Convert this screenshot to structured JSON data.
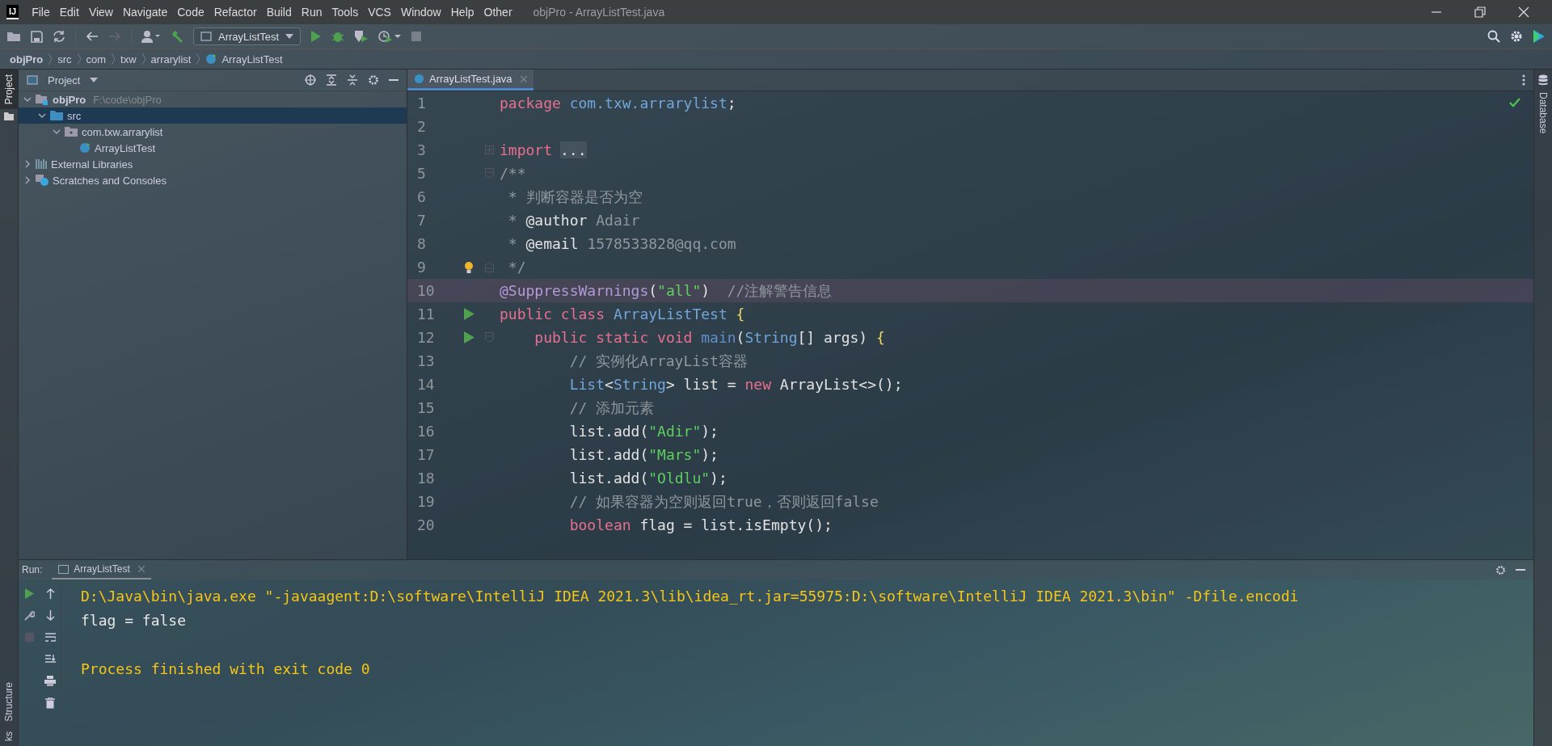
{
  "window": {
    "logo_text": "IJ",
    "title": "objPro - ArrayListTest.java"
  },
  "menu": [
    "File",
    "Edit",
    "View",
    "Navigate",
    "Code",
    "Refactor",
    "Build",
    "Run",
    "Tools",
    "VCS",
    "Window",
    "Help",
    "Other"
  ],
  "toolbar": {
    "run_config": "ArrayListTest"
  },
  "breadcrumbs": [
    "objPro",
    "src",
    "com",
    "txw",
    "arrarylist",
    "ArrayListTest"
  ],
  "left_stripe": {
    "top": [
      {
        "label": "Project",
        "selected": true
      }
    ],
    "bottom": [
      {
        "label": "Structure",
        "selected": false
      },
      {
        "label": "ks",
        "selected": false
      }
    ]
  },
  "right_stripe": [
    {
      "label": "Database",
      "selected": false
    }
  ],
  "project": {
    "title": "Project",
    "tree": [
      {
        "label": "objPro",
        "path": "F:\\code\\objPro",
        "kind": "module",
        "expanded": true,
        "selected": false,
        "children": [
          {
            "label": "src",
            "kind": "folder",
            "expanded": true,
            "selected": true,
            "children": [
              {
                "label": "com.txw.arrarylist",
                "kind": "package",
                "expanded": true,
                "selected": false,
                "children": [
                  {
                    "label": "ArrayListTest",
                    "kind": "class",
                    "selected": false
                  }
                ]
              }
            ]
          }
        ]
      },
      {
        "label": "External Libraries",
        "kind": "library",
        "expanded": false,
        "selected": false
      },
      {
        "label": "Scratches and Consoles",
        "kind": "scratches",
        "expanded": false,
        "selected": false
      }
    ]
  },
  "editor": {
    "tabs": [
      {
        "label": "ArrayListTest.java",
        "selected": true
      }
    ],
    "lines": [
      {
        "number": "1",
        "current": false,
        "tokens": [
          {
            "kind": "kw",
            "text": "package"
          },
          {
            "kind": "type",
            "text": " com.txw.arrarylist"
          },
          {
            "kind": "plain",
            "text": ";"
          }
        ]
      },
      {
        "number": "2",
        "current": false
      },
      {
        "number": "3",
        "current": false,
        "marks": [
          {
            "kind": "fold-plus"
          }
        ],
        "tokens": [
          {
            "kind": "kw",
            "text": "import"
          },
          {
            "kind": "folded",
            "text": "..."
          }
        ]
      },
      {
        "number": "5",
        "current": false,
        "marks": [
          {
            "kind": "fold-start"
          }
        ],
        "tokens": [
          {
            "kind": "com",
            "text": "/**"
          }
        ]
      },
      {
        "number": "6",
        "current": false,
        "tokens": [
          {
            "kind": "com",
            "text": " * 判断容器是否为空"
          }
        ]
      },
      {
        "number": "7",
        "current": false,
        "tokens": [
          {
            "kind": "com",
            "text": " *"
          },
          {
            "kind": "doctag",
            "text": " @author"
          },
          {
            "kind": "com",
            "text": " Adair"
          }
        ]
      },
      {
        "number": "8",
        "current": false,
        "tokens": [
          {
            "kind": "com",
            "text": " *"
          },
          {
            "kind": "doctag",
            "text": " @email"
          },
          {
            "kind": "com",
            "text": " 1578533828@qq.com"
          }
        ]
      },
      {
        "number": "9",
        "current": false,
        "marks": [
          {
            "kind": "fold-end"
          },
          {
            "kind": "bulb"
          }
        ],
        "tokens": [
          {
            "kind": "com",
            "text": " */"
          }
        ]
      },
      {
        "number": "10",
        "current": true,
        "tokens": [
          {
            "kind": "ann",
            "text": "@SuppressWarnings"
          },
          {
            "kind": "plain",
            "text": "("
          },
          {
            "kind": "str",
            "text": "\"all\""
          },
          {
            "kind": "plain",
            "text": ")"
          },
          {
            "kind": "com",
            "text": "  //注解警告信息"
          }
        ]
      },
      {
        "number": "11",
        "current": false,
        "marks": [
          {
            "kind": "run"
          }
        ],
        "tokens": [
          {
            "kind": "kw",
            "text": "public class"
          },
          {
            "kind": "type",
            "text": " ArrayListTest"
          },
          {
            "kind": "brace",
            "text": " {"
          }
        ]
      },
      {
        "number": "12",
        "current": false,
        "marks": [
          {
            "kind": "run"
          },
          {
            "kind": "fold-start"
          }
        ],
        "tokens": [
          {
            "kind": "kw",
            "text": "    public static void"
          },
          {
            "kind": "fn",
            "text": " main"
          },
          {
            "kind": "plain",
            "text": "("
          },
          {
            "kind": "type",
            "text": "String"
          },
          {
            "kind": "plain",
            "text": "[] args)"
          },
          {
            "kind": "brace",
            "text": " {"
          }
        ]
      },
      {
        "number": "13",
        "current": false,
        "tokens": [
          {
            "kind": "com",
            "text": "        // 实例化ArrayList容器"
          }
        ]
      },
      {
        "number": "14",
        "current": false,
        "tokens": [
          {
            "kind": "type",
            "text": "        List"
          },
          {
            "kind": "plain",
            "text": "<"
          },
          {
            "kind": "type",
            "text": "String"
          },
          {
            "kind": "plain",
            "text": "> list = "
          },
          {
            "kind": "kw",
            "text": "new"
          },
          {
            "kind": "plain",
            "text": " ArrayList<>();"
          }
        ]
      },
      {
        "number": "15",
        "current": false,
        "tokens": [
          {
            "kind": "com",
            "text": "        // 添加元素"
          }
        ]
      },
      {
        "number": "16",
        "current": false,
        "tokens": [
          {
            "kind": "plain",
            "text": "        list.add("
          },
          {
            "kind": "str",
            "text": "\"Adir\""
          },
          {
            "kind": "plain",
            "text": ");"
          }
        ]
      },
      {
        "number": "17",
        "current": false,
        "tokens": [
          {
            "kind": "plain",
            "text": "        list.add("
          },
          {
            "kind": "str",
            "text": "\"Mars\""
          },
          {
            "kind": "plain",
            "text": ");"
          }
        ]
      },
      {
        "number": "18",
        "current": false,
        "tokens": [
          {
            "kind": "plain",
            "text": "        list.add("
          },
          {
            "kind": "str",
            "text": "\"Oldlu\""
          },
          {
            "kind": "plain",
            "text": ");"
          }
        ]
      },
      {
        "number": "19",
        "current": false,
        "tokens": [
          {
            "kind": "com",
            "text": "        // 如果容器为空则返回true，否则返回false"
          }
        ]
      },
      {
        "number": "20",
        "current": false,
        "tokens": [
          {
            "kind": "kw",
            "text": "        boolean"
          },
          {
            "kind": "plain",
            "text": " flag = list.isEmpty();"
          }
        ]
      }
    ]
  },
  "run": {
    "label": "Run:",
    "tabs": [
      {
        "label": "ArrayListTest",
        "selected": true
      }
    ],
    "console": [
      {
        "kind": "command",
        "text": "D:\\Java\\bin\\java.exe \"-javaagent:D:\\software\\IntelliJ IDEA 2021.3\\lib\\idea_rt.jar=55975:D:\\software\\IntelliJ IDEA 2021.3\\bin\" -Dfile.encodi"
      },
      {
        "kind": "output",
        "text": "flag = false"
      },
      {
        "kind": "blank"
      },
      {
        "kind": "status",
        "text": "Process finished with exit code 0"
      }
    ]
  }
}
